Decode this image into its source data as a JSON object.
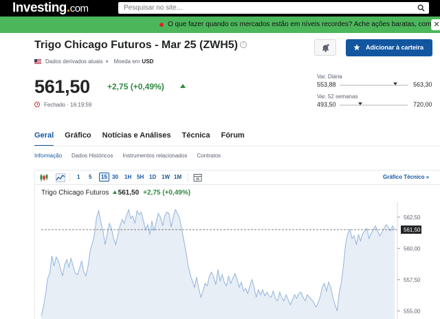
{
  "header": {
    "logo_main": "Investing",
    "logo_suffix": "com",
    "search_placeholder": "Pesquisar no site..."
  },
  "banner": {
    "text": "O que fazer quando os mercados estão em níveis recordes? Ache ações baratas, como essas.",
    "close": "✕"
  },
  "instrument": {
    "title": "Trigo Chicago Futuros - Mar 25 (ZWH5)",
    "derived_data": "Dados derivados atuais",
    "currency_label": "Moeda em",
    "currency": "USD",
    "price": "561,50",
    "change": "+2,75 (+0,49%)",
    "status": "Fechado · 16:19:59",
    "add_button": "Adicionar à carteira"
  },
  "ranges": {
    "daily": {
      "label": "Var. Diária",
      "low": "553,88",
      "high": "563,30",
      "position": 0.82
    },
    "week52": {
      "label": "Var. 52 semanas",
      "low": "493,50",
      "high": "720,00",
      "position": 0.3
    }
  },
  "tabs": [
    "Geral",
    "Gráfico",
    "Notícias e Análises",
    "Técnica",
    "Fórum"
  ],
  "subtabs": [
    "Informação",
    "Dados Históricos",
    "Instrumentos relacionados",
    "Contratos"
  ],
  "chart_toolbar": {
    "timeframes": [
      "1",
      "5",
      "15",
      "30",
      "1H",
      "5H",
      "1D",
      "1W",
      "1M"
    ],
    "selected": "15",
    "tech_link": "Gráfico Técnico »"
  },
  "chart_legend": {
    "name": "Trigo Chicago Futuros",
    "price": "561,50",
    "change": "+2,75 (+0,49%)"
  },
  "colors": {
    "accent": "#1256a0",
    "positive": "#2f8a41",
    "banner_bg": "#4cb65b",
    "line": "#8fb4dc",
    "area": "#e8eef6"
  },
  "chart_data": {
    "type": "area",
    "yticks": [
      "562,50",
      "560,00",
      "557,50",
      "555,00"
    ],
    "ytick_values": [
      562.5,
      560.0,
      557.5,
      555.0
    ],
    "ylim": [
      554.3,
      563.7
    ],
    "last_price": 561.5,
    "last_label": "561,50",
    "values": [
      554.6,
      555.3,
      556.3,
      557.6,
      558.0,
      559.4,
      558.6,
      559.3,
      559.0,
      558.4,
      557.8,
      558.7,
      559.1,
      558.5,
      559.2,
      558.6,
      558.0,
      557.9,
      558.4,
      559.0,
      558.1,
      557.8,
      558.6,
      559.8,
      560.4,
      561.1,
      562.5,
      563.0,
      562.1,
      561.4,
      560.3,
      561.2,
      562.0,
      561.6,
      560.8,
      560.3,
      561.1,
      561.8,
      562.3,
      562.0,
      562.6,
      563.1,
      562.4,
      562.6,
      562.0,
      563.0,
      562.7,
      562.9,
      562.2,
      561.5,
      561.9,
      561.1,
      562.2,
      561.4,
      562.1,
      562.8,
      562.5,
      561.8,
      562.6,
      562.9,
      562.8,
      561.7,
      562.5,
      563.1,
      562.8,
      562.4,
      561.5,
      560.6,
      559.7,
      558.6,
      557.9,
      557.4,
      556.9,
      557.7,
      556.8,
      556.1,
      556.6,
      557.2,
      557.0,
      557.8,
      558.1,
      557.7,
      557.1,
      558.3,
      557.4,
      557.9,
      557.3,
      557.0,
      557.8,
      557.2,
      557.6,
      558.0,
      557.5,
      556.9,
      557.3,
      556.6,
      556.8,
      556.4,
      557.0,
      557.5,
      556.9,
      556.1,
      556.7,
      556.3,
      556.7,
      556.2,
      556.5,
      556.2,
      556.1,
      556.6,
      556.0,
      555.8,
      556.5,
      556.1,
      555.8,
      556.3,
      555.9,
      555.5,
      555.9,
      556.3,
      556.0,
      556.4,
      556.5,
      556.1,
      555.8,
      556.3,
      556.1,
      555.9,
      555.7,
      555.3,
      555.6,
      556.1,
      556.9,
      557.2,
      556.6,
      557.3,
      556.9,
      556.1,
      555.5,
      555.0,
      556.5,
      557.3,
      558.7,
      560.4,
      561.2,
      561.5,
      560.8,
      561.0,
      560.3,
      561.1,
      560.6,
      561.2,
      561.4,
      561.6,
      560.8,
      561.2,
      561.5,
      561.8,
      561.4,
      561.0,
      561.3,
      561.6,
      561.9,
      561.7,
      561.4,
      561.8,
      561.5
    ]
  }
}
